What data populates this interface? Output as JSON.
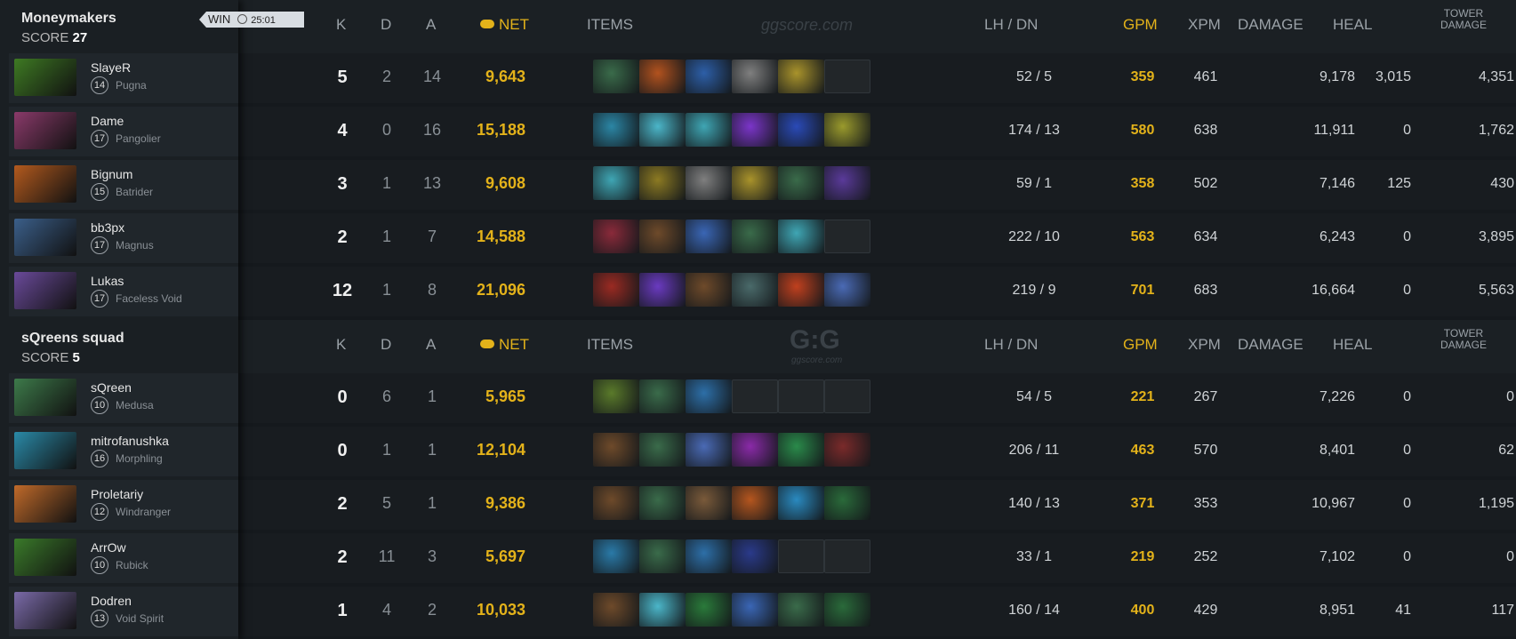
{
  "columns": {
    "k": "K",
    "d": "D",
    "a": "A",
    "net": "NET",
    "items": "ITEMS",
    "lhdn": "LH  /  DN",
    "gpm": "GPM",
    "xpm": "XPM",
    "damage": "DAMAGE",
    "heal": "HEAL",
    "tower_line1": "TOWER",
    "tower_line2": "DAMAGE"
  },
  "watermark": {
    "top": "ggscore.com",
    "logo": "G:G",
    "sub": "ggscore.com"
  },
  "teams": [
    {
      "name": "Moneymakers",
      "score_label": "SCORE",
      "score": "27",
      "result": "WIN",
      "duration": "25:01",
      "players": [
        {
          "name": "SlayeR",
          "level": "14",
          "hero": "Pugna",
          "k": "5",
          "d": "2",
          "a": "14",
          "net": "9,643",
          "lhdn": "52  /  5",
          "gpm": "359",
          "xpm": "461",
          "damage": "9,178",
          "heal": "3,015",
          "tower": "4,351",
          "portrait_color": "#3e7a23",
          "items": [
            "#3a6b4a",
            "#b2521e",
            "#2d5fa8",
            "#7f7f7f",
            "#a9932b",
            "empty"
          ]
        },
        {
          "name": "Dame",
          "level": "17",
          "hero": "Pangolier",
          "k": "4",
          "d": "0",
          "a": "16",
          "net": "15,188",
          "lhdn": "174  /  13",
          "gpm": "580",
          "xpm": "638",
          "damage": "11,911",
          "heal": "0",
          "tower": "1,762",
          "portrait_color": "#8a3a6a",
          "items": [
            "#2b86a5",
            "#4bb6c9",
            "#3fa6b4",
            "#7b35c9",
            "#2a4ab7",
            "#9a9a2c"
          ]
        },
        {
          "name": "Bignum",
          "level": "15",
          "hero": "Batrider",
          "k": "3",
          "d": "1",
          "a": "13",
          "net": "9,608",
          "lhdn": "59  /  1",
          "gpm": "358",
          "xpm": "502",
          "damage": "7,146",
          "heal": "125",
          "tower": "430",
          "portrait_color": "#b35a1e",
          "items": [
            "#3fa6b4",
            "#8c7a22",
            "#7f7f7f",
            "#a9932b",
            "#3a6b4a",
            "#5a3a9a"
          ]
        },
        {
          "name": "bb3px",
          "level": "17",
          "hero": "Magnus",
          "k": "2",
          "d": "1",
          "a": "7",
          "net": "14,588",
          "lhdn": "222  /  10",
          "gpm": "563",
          "xpm": "634",
          "damage": "6,243",
          "heal": "0",
          "tower": "3,895",
          "portrait_color": "#3b5f8a",
          "items": [
            "#8a2a3a",
            "#6e4a2a",
            "#3a66b5",
            "#3a6b4a",
            "#3fa6b4",
            "empty"
          ]
        },
        {
          "name": "Lukas",
          "level": "17",
          "hero": "Faceless Void",
          "k": "12",
          "d": "1",
          "a": "8",
          "net": "21,096",
          "lhdn": "219  /  9",
          "gpm": "701",
          "xpm": "683",
          "damage": "16,664",
          "heal": "0",
          "tower": "5,563",
          "portrait_color": "#6a4a9a",
          "items": [
            "#9a2a22",
            "#6a3ac0",
            "#6e4a2a",
            "#4a6a6a",
            "#c0401e",
            "#4a6ab5"
          ]
        }
      ]
    },
    {
      "name": "sQreens squad",
      "score_label": "SCORE",
      "score": "5",
      "players": [
        {
          "name": "sQreen",
          "level": "10",
          "hero": "Medusa",
          "k": "0",
          "d": "6",
          "a": "1",
          "net": "5,965",
          "lhdn": "54  /  5",
          "gpm": "221",
          "xpm": "267",
          "damage": "7,226",
          "heal": "0",
          "tower": "0",
          "portrait_color": "#3d7a4a",
          "items": [
            "#5a7a2a",
            "#3a6b4a",
            "#2d6fa8",
            "empty",
            "empty",
            "empty"
          ]
        },
        {
          "name": "mitrofanushka",
          "level": "16",
          "hero": "Morphling",
          "k": "0",
          "d": "1",
          "a": "1",
          "net": "12,104",
          "lhdn": "206  /  11",
          "gpm": "463",
          "xpm": "570",
          "damage": "8,401",
          "heal": "0",
          "tower": "62",
          "portrait_color": "#2a8aa8",
          "items": [
            "#6e4a2a",
            "#3a6b4a",
            "#4a6ab5",
            "#8a2aa8",
            "#2a8a4a",
            "#7a2a2a"
          ]
        },
        {
          "name": "Proletariy",
          "level": "12",
          "hero": "Windranger",
          "k": "2",
          "d": "5",
          "a": "1",
          "net": "9,386",
          "lhdn": "140  /  13",
          "gpm": "371",
          "xpm": "353",
          "damage": "10,967",
          "heal": "0",
          "tower": "1,195",
          "portrait_color": "#c06a2a",
          "items": [
            "#6e4a2a",
            "#3a6b4a",
            "#7a5a3a",
            "#b5561e",
            "#2a8ac0",
            "#2a6a3a"
          ]
        },
        {
          "name": "ArrOw",
          "level": "10",
          "hero": "Rubick",
          "k": "2",
          "d": "11",
          "a": "3",
          "net": "5,697",
          "lhdn": "33  /  1",
          "gpm": "219",
          "xpm": "252",
          "damage": "7,102",
          "heal": "0",
          "tower": "0",
          "portrait_color": "#3a7a2a",
          "items": [
            "#2a7aa8",
            "#3a6b4a",
            "#2d6fa8",
            "#2a3a8a",
            "empty",
            "empty"
          ]
        },
        {
          "name": "Dodren",
          "level": "13",
          "hero": "Void Spirit",
          "k": "1",
          "d": "4",
          "a": "2",
          "net": "10,033",
          "lhdn": "160  /  14",
          "gpm": "400",
          "xpm": "429",
          "damage": "8,951",
          "heal": "41",
          "tower": "117",
          "portrait_color": "#7a6aa8",
          "items": [
            "#6e4a2a",
            "#4bb6c9",
            "#2a7a3a",
            "#3a66b5",
            "#3a6b4a",
            "#2a6a3a"
          ]
        }
      ]
    }
  ]
}
